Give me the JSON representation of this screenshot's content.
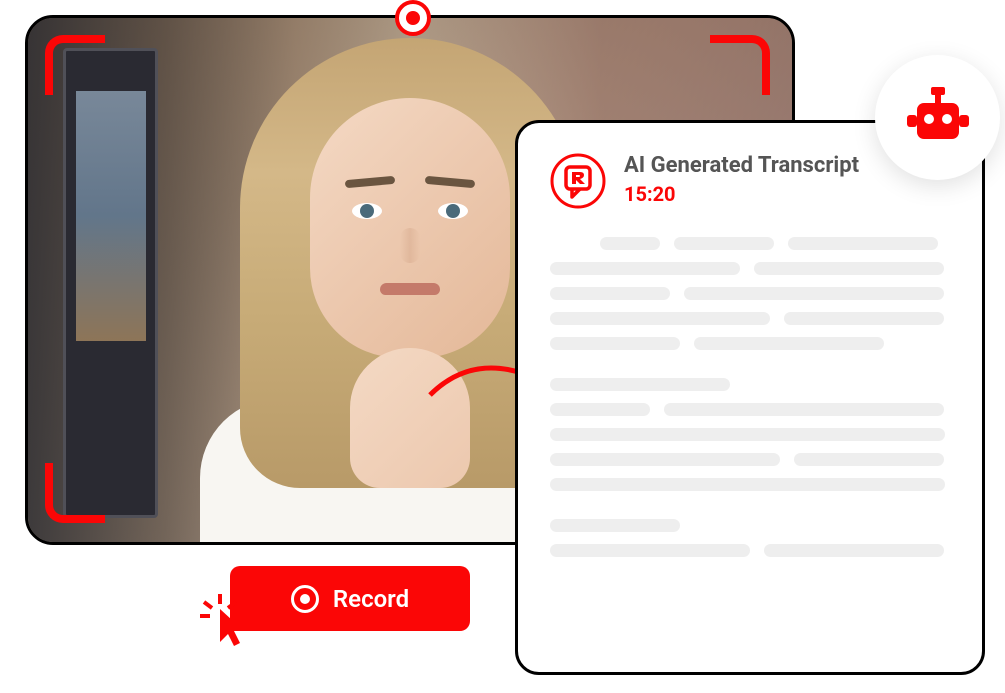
{
  "record": {
    "button_label": "Record"
  },
  "transcript": {
    "title": "AI Generated Transcript",
    "timestamp": "15:20"
  },
  "colors": {
    "accent": "#fb0606",
    "text_muted": "#555555",
    "skeleton": "#eeeeee"
  },
  "icons": {
    "record": "record-icon",
    "logo": "r-logo",
    "bot": "robot-icon",
    "cursor": "click-cursor-icon"
  }
}
